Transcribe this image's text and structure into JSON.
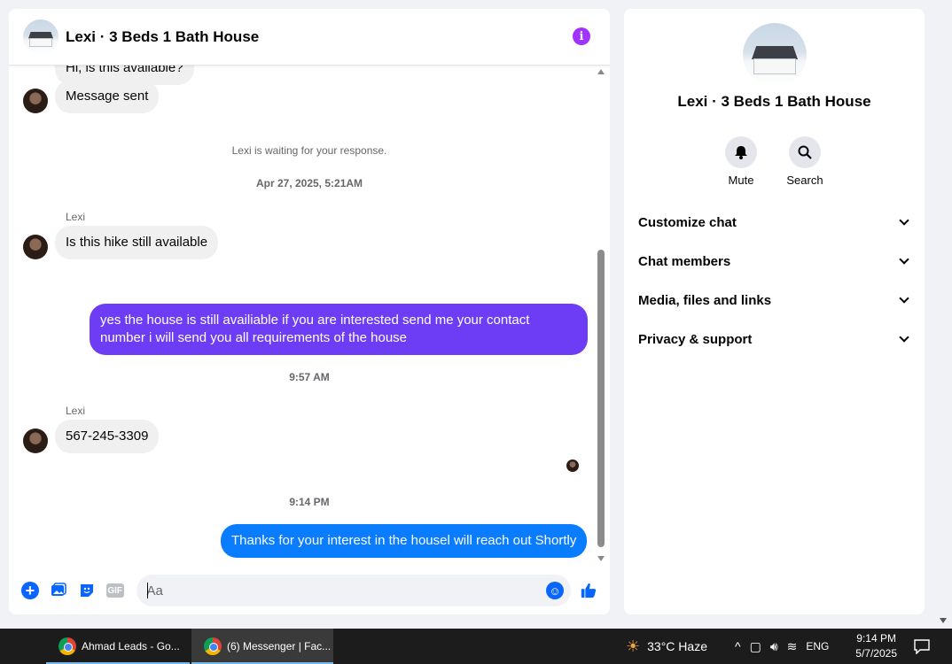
{
  "chat": {
    "title": "Lexi · 3 Beds 1 Bath House",
    "partial_top_message": "Hi, is this available?",
    "messages": {
      "m1": "Message sent",
      "system": "Lexi is waiting for your response.",
      "ts1": "Apr 27, 2025, 5:21AM",
      "sender1": "Lexi",
      "m2": "Is this hike still available",
      "m3": "yes the house is still availiable if you are interested send me your contact number i will send you all requirements of the house",
      "ts2": "9:57 AM",
      "sender2": "Lexi",
      "m4": "567-245-3309",
      "ts3": "9:14 PM",
      "m5": "Thanks for your interest in the housel will reach out Shortly"
    },
    "composer": {
      "placeholder": "Aa"
    }
  },
  "info_panel": {
    "title": "Lexi · 3 Beds 1 Bath House",
    "actions": {
      "mute": "Mute",
      "search": "Search"
    },
    "sections": [
      "Customize chat",
      "Chat members",
      "Media, files and links",
      "Privacy & support"
    ]
  },
  "taskbar": {
    "apps": [
      "Ahmad Leads - Go...",
      "(6) Messenger | Fac..."
    ],
    "weather": "33°C  Haze",
    "language": "ENG",
    "time": "9:14 PM",
    "date": "5/7/2025"
  },
  "colors": {
    "accent": "#0866ff",
    "purple_bubble": "#6d3cf5",
    "blue_bubble": "#0a7cff",
    "info_icon": "#a033ff"
  }
}
